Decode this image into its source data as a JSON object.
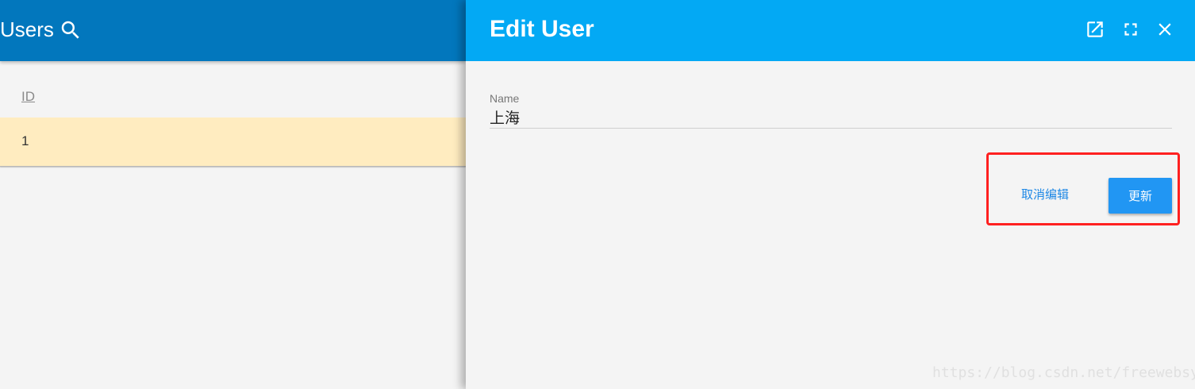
{
  "users_panel": {
    "title": "Users",
    "search_icon": "search-icon",
    "columns": [
      {
        "label": "ID"
      }
    ],
    "rows": [
      {
        "id": "1"
      }
    ]
  },
  "edit_panel": {
    "title": "Edit User",
    "header_icons": [
      "open-in-new-icon",
      "fullscreen-icon",
      "close-icon"
    ],
    "name_field": {
      "label": "Name",
      "value": "上海"
    },
    "actions": {
      "cancel_label": "取消编辑",
      "update_label": "更新"
    },
    "highlight_color": "#ff2020"
  },
  "colors": {
    "users_header": "#0277bd",
    "edit_header": "#03a9f4",
    "selected_row": "#ffecc0",
    "primary_button": "#2196f3"
  },
  "watermark": "https://blog.csdn.net/freewebsys"
}
